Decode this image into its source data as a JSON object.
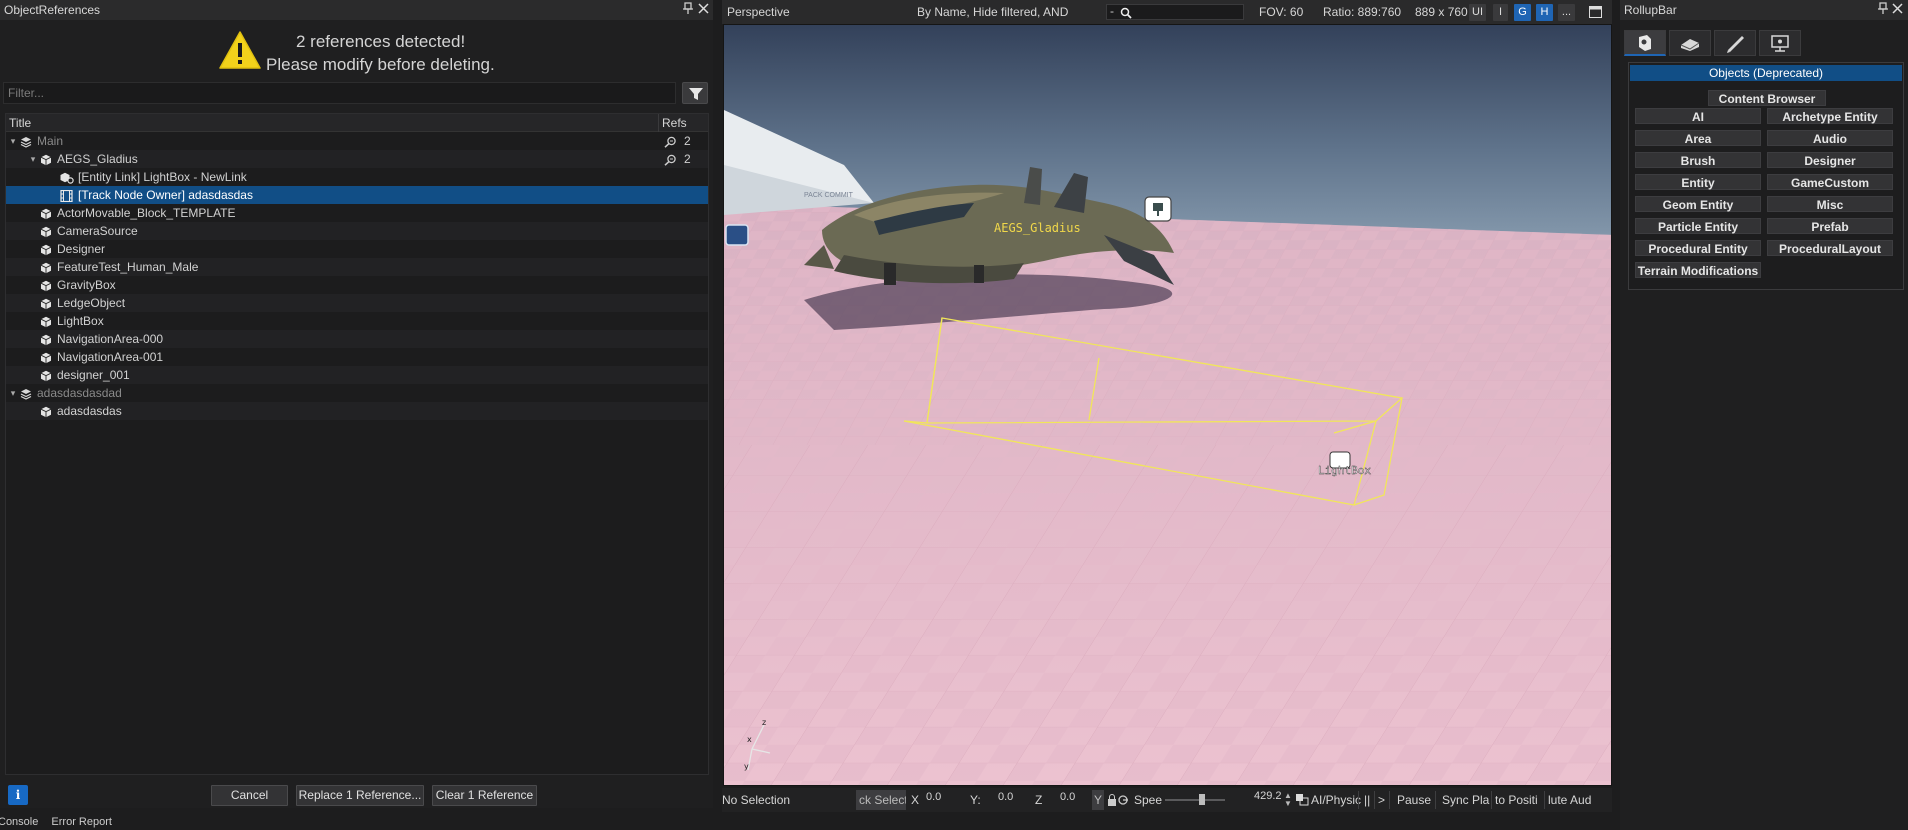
{
  "left_panel": {
    "title": "ObjectReferences",
    "pin_glyph": "⌂",
    "close_glyph": "✕",
    "warning": {
      "icon": "warning-triangle-icon",
      "line1": "2 references detected!",
      "line2": "Please modify before deleting."
    },
    "filter": {
      "placeholder": "Filter...",
      "value": "",
      "icon": "funnel-icon"
    },
    "columns": {
      "title": "Title",
      "refs": "Refs"
    },
    "rows": [
      {
        "label": "Main",
        "icon": "layer-icon",
        "expander": "▾",
        "level": 0,
        "kind": "layer",
        "refs": "2"
      },
      {
        "label": "AEGS_Gladius",
        "icon": "object-cube-icon",
        "expander": "▾",
        "level": 1,
        "kind": "object",
        "refs": "2"
      },
      {
        "label": "[Entity Link] LightBox - NewLink",
        "icon": "entity-link-icon",
        "expander": "",
        "level": 2,
        "kind": "link",
        "refs": ""
      },
      {
        "label": "[Track Node Owner] adasdasdas",
        "icon": "film-strip-icon",
        "expander": "",
        "level": 2,
        "kind": "track",
        "refs": "",
        "selected": true
      },
      {
        "label": "ActorMovable_Block_TEMPLATE",
        "icon": "object-cube-icon",
        "expander": "",
        "level": 1,
        "kind": "object",
        "refs": ""
      },
      {
        "label": "CameraSource",
        "icon": "object-cube-icon",
        "expander": "",
        "level": 1,
        "kind": "object",
        "refs": ""
      },
      {
        "label": "Designer",
        "icon": "object-cube-icon",
        "expander": "",
        "level": 1,
        "kind": "object",
        "refs": ""
      },
      {
        "label": "FeatureTest_Human_Male",
        "icon": "object-cube-icon",
        "expander": "",
        "level": 1,
        "kind": "object",
        "refs": ""
      },
      {
        "label": "GravityBox",
        "icon": "object-cube-icon",
        "expander": "",
        "level": 1,
        "kind": "object",
        "refs": ""
      },
      {
        "label": "LedgeObject",
        "icon": "object-cube-icon",
        "expander": "",
        "level": 1,
        "kind": "object",
        "refs": ""
      },
      {
        "label": "LightBox",
        "icon": "object-cube-icon",
        "expander": "",
        "level": 1,
        "kind": "object",
        "refs": ""
      },
      {
        "label": "NavigationArea-000",
        "icon": "object-cube-icon",
        "expander": "",
        "level": 1,
        "kind": "object",
        "refs": ""
      },
      {
        "label": "NavigationArea-001",
        "icon": "object-cube-icon",
        "expander": "",
        "level": 1,
        "kind": "object",
        "refs": ""
      },
      {
        "label": "designer_001",
        "icon": "object-cube-icon",
        "expander": "",
        "level": 1,
        "kind": "object",
        "refs": ""
      },
      {
        "label": "adasdasdasdad",
        "icon": "layer-icon",
        "expander": "▾",
        "level": 0,
        "kind": "layer",
        "refs": ""
      },
      {
        "label": "adasdasdas",
        "icon": "object-cube-icon",
        "expander": "",
        "level": 1,
        "kind": "object",
        "refs": ""
      }
    ],
    "buttons": {
      "info": "i",
      "cancel": "Cancel",
      "replace": "Replace 1 Reference...",
      "clear": "Clear 1 Reference"
    },
    "status_tabs": [
      "Console",
      "Error Report"
    ]
  },
  "viewport_bar": {
    "view_name": "Perspective",
    "filter_mode": "By Name, Hide filtered, AND",
    "search_prefix": "-",
    "search_icon": "search-icon",
    "fov": "FOV: 60",
    "ratio": "Ratio: 889:760",
    "size": "889 x 760",
    "toggles": [
      {
        "label": "UI",
        "on": false
      },
      {
        "label": "I",
        "on": false
      },
      {
        "label": "G",
        "on": true
      },
      {
        "label": "H",
        "on": true
      },
      {
        "label": "...",
        "on": false
      }
    ],
    "maximize_icon": "maximize-icon"
  },
  "viewport": {
    "ship_label": "AEGS_Gladius",
    "lightbox_label": "LightBox",
    "sign_text": "PACK COMMIT"
  },
  "viewport_status": {
    "selection": "No Selection",
    "lock_selection": "ck Selecti",
    "x_label": "X",
    "x_value": "0.0",
    "y_label": "Y:",
    "y_value": "0.0",
    "z_label": "Z",
    "z_value": "0.0",
    "y_toggle": "Y",
    "speed_label": "Spee",
    "speed_value": "429.2",
    "physics": "AI/Physic",
    "pause_sep": "||",
    "arrow": ">",
    "pause": "Pause",
    "sync": "Sync Pla",
    "goto": "to Positi",
    "mute": "lute Aud"
  },
  "rollup": {
    "title": "RollupBar",
    "tabs": [
      "objects-tab-icon",
      "terrain-tab-icon",
      "modify-tab-icon",
      "display-tab-icon"
    ],
    "header": "Objects (Deprecated)",
    "content_browser": "Content Browser",
    "buttons": [
      "AI",
      "Archetype Entity",
      "Area",
      "Audio",
      "Brush",
      "Designer",
      "Entity",
      "GameCustom",
      "Geom Entity",
      "Misc",
      "Particle Entity",
      "Prefab",
      "Procedural Entity",
      "ProceduralLayout",
      "Terrain Modifications"
    ]
  }
}
